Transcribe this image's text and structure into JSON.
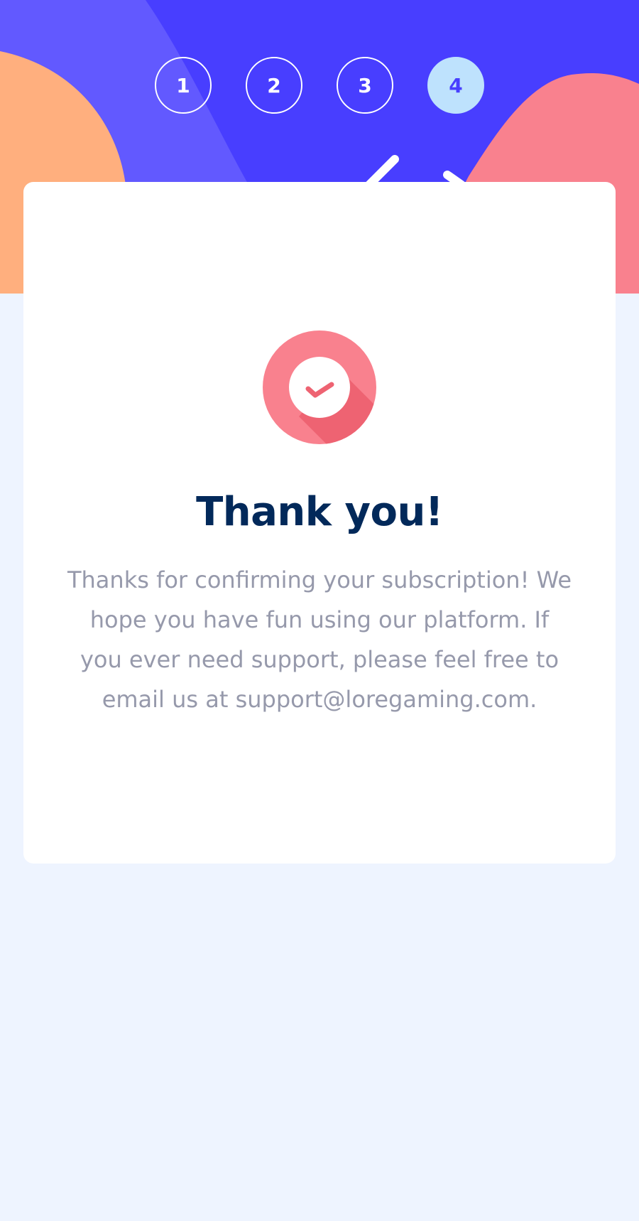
{
  "steps": [
    {
      "label": "1",
      "active": false
    },
    {
      "label": "2",
      "active": false
    },
    {
      "label": "3",
      "active": false
    },
    {
      "label": "4",
      "active": true
    }
  ],
  "confirmation": {
    "icon": "checkmark-circle-icon",
    "title": "Thank you!",
    "message": "Thanks for confirming your subscription! We hope you have fun using our platform. If you ever need support, please feel free to email us at support@loregaming.com."
  },
  "colors": {
    "primary": "#483eff",
    "primary_light": "#6259ff",
    "orange": "#ffaf7e",
    "pink": "#f9818e",
    "pink_dark": "#ee6372",
    "active_step_bg": "#bee2fd",
    "title": "#02295a",
    "text": "#9699ab",
    "background": "#eef4ff"
  }
}
